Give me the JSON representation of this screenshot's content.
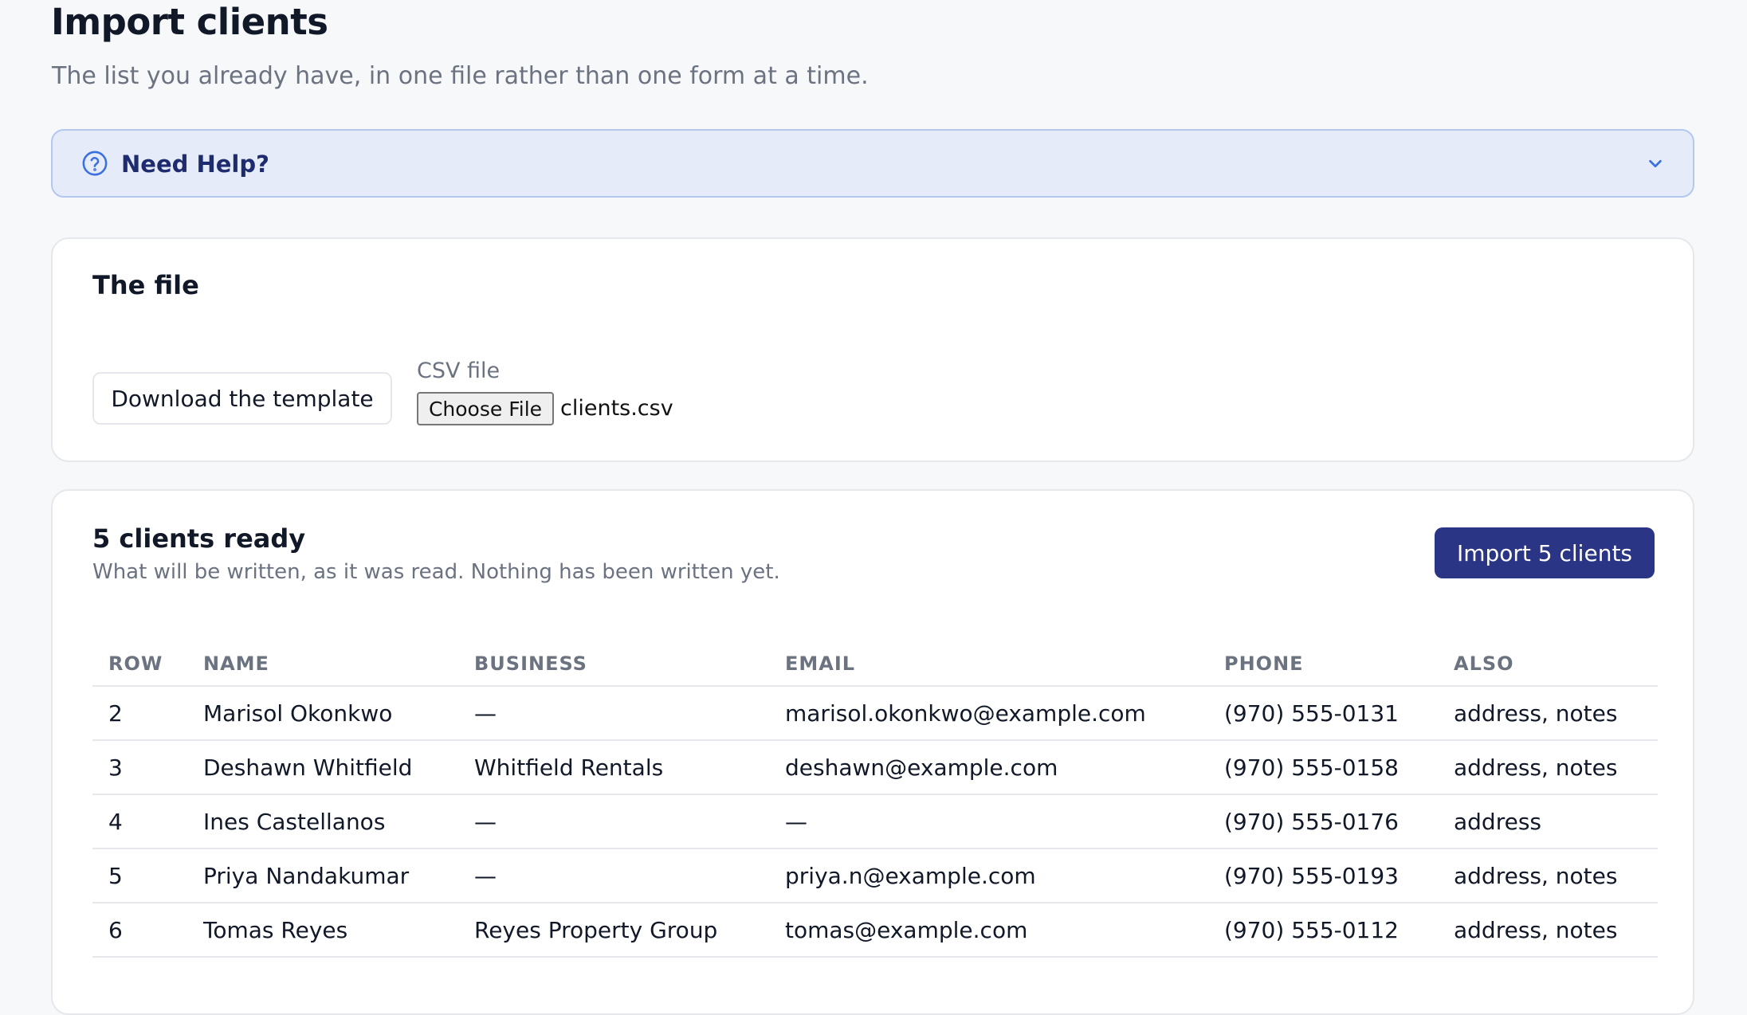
{
  "page": {
    "title": "Import clients",
    "subtitle": "The list you already have, in one file rather than one form at a time."
  },
  "help": {
    "label": "Need Help?",
    "icon": "question-circle-icon",
    "toggle_icon": "chevron-down-icon"
  },
  "file_section": {
    "title": "The file",
    "download_label": "Download the template",
    "csv_label": "CSV file",
    "choose_label": "Choose File",
    "file_name": "clients.csv"
  },
  "clients_section": {
    "title": "5 clients ready",
    "description": "What will be written, as it was read. Nothing has been written yet.",
    "import_label": "Import 5 clients",
    "columns": [
      "ROW",
      "NAME",
      "BUSINESS",
      "EMAIL",
      "PHONE",
      "ALSO"
    ],
    "rows": [
      {
        "row": "2",
        "name": "Marisol Okonkwo",
        "business": "—",
        "email": "marisol.okonkwo@example.com",
        "phone": "(970) 555-0131",
        "also": "address, notes"
      },
      {
        "row": "3",
        "name": "Deshawn Whitfield",
        "business": "Whitfield Rentals",
        "email": "deshawn@example.com",
        "phone": "(970) 555-0158",
        "also": "address, notes"
      },
      {
        "row": "4",
        "name": "Ines Castellanos",
        "business": "—",
        "email": "—",
        "phone": "(970) 555-0176",
        "also": "address"
      },
      {
        "row": "5",
        "name": "Priya Nandakumar",
        "business": "—",
        "email": "priya.n@example.com",
        "phone": "(970) 555-0193",
        "also": "address, notes"
      },
      {
        "row": "6",
        "name": "Tomas Reyes",
        "business": "Reyes Property Group",
        "email": "tomas@example.com",
        "phone": "(970) 555-0112",
        "also": "address, notes"
      }
    ]
  },
  "colors": {
    "accent": "#2b3585",
    "help_background": "#e5ebf8",
    "help_border": "#b4c7f0",
    "help_text": "#1e2b6e",
    "help_icon": "#3b6fe0"
  }
}
